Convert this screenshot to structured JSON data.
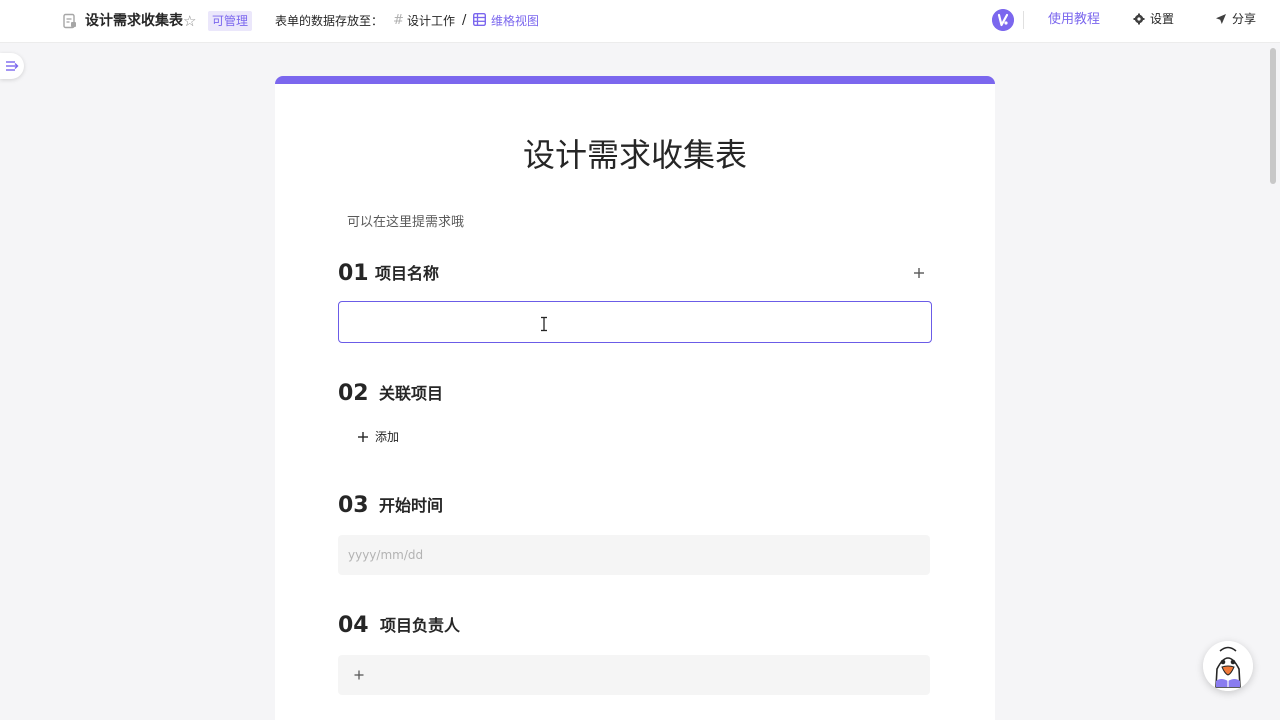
{
  "header": {
    "doc_icon": "form-doc-icon",
    "title": "设计需求收集表",
    "star_icon": "star-icon",
    "star_glyph": "☆",
    "permission_badge": "可管理",
    "storage_label": "表单的数据存放至：",
    "space_icon": "hash-icon",
    "hash_glyph": "#",
    "space_name": "设计工作",
    "separator": "/",
    "view_icon": "table-view-icon",
    "view_name": "维格视图",
    "tutorial_label": "使用教程",
    "settings_label": "设置",
    "share_label": "分享",
    "accent_color": "#7b67ee"
  },
  "form": {
    "title": "设计需求收集表",
    "description": "可以在这里提需求哦",
    "questions": [
      {
        "number": "01",
        "title": "项目名称",
        "type": "text",
        "value": ""
      },
      {
        "number": "02",
        "title": "关联项目",
        "type": "link",
        "add_label": "添加"
      },
      {
        "number": "03",
        "title": "开始时间",
        "type": "date",
        "placeholder": "yyyy/mm/dd"
      },
      {
        "number": "04",
        "title": "项目负责人",
        "type": "member"
      }
    ]
  }
}
